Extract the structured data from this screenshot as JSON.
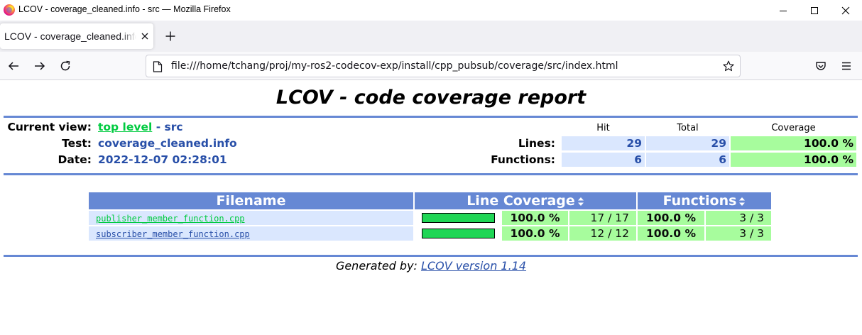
{
  "window": {
    "title": "LCOV - coverage_cleaned.info - src — Mozilla Firefox"
  },
  "tab": {
    "title": "LCOV - coverage_cleaned.info - src"
  },
  "navbar": {
    "url": "file:///home/tchang/proj/my-ros2-codecov-exp/install/cpp_pubsub/coverage/src/index.html"
  },
  "page": {
    "title": "LCOV - code coverage report",
    "header": {
      "current_view_label": "Current view:",
      "current_view_link": "top level",
      "current_view_rest": " - src",
      "test_label": "Test:",
      "test_value": "coverage_cleaned.info",
      "date_label": "Date:",
      "date_value": "2022-12-07 02:28:01",
      "col_hit": "Hit",
      "col_total": "Total",
      "col_coverage": "Coverage",
      "lines_label": "Lines:",
      "lines_hit": "29",
      "lines_total": "29",
      "lines_coverage": "100.0 %",
      "functions_label": "Functions:",
      "functions_hit": "6",
      "functions_total": "6",
      "functions_coverage": "100.0 %"
    },
    "table": {
      "headers": {
        "filename": "Filename",
        "line_coverage": "Line Coverage",
        "functions": "Functions"
      },
      "rows": [
        {
          "file": "publisher_member_function.cpp",
          "bar_fraction": 1.0,
          "line_pct": "100.0 %",
          "line_ratio": "17 / 17",
          "func_pct": "100.0 %",
          "func_ratio": "3 / 3"
        },
        {
          "file": "subscriber_member_function.cpp",
          "bar_fraction": 1.0,
          "line_pct": "100.0 %",
          "line_ratio": "12 / 12",
          "func_pct": "100.0 %",
          "func_ratio": "3 / 3"
        }
      ]
    },
    "footer": {
      "prefix": "Generated by:",
      "link": "LCOV version 1.14"
    }
  },
  "colors": {
    "ruler": "#6688d4",
    "value_blue": "#284fa8",
    "hit_bg": "#dae7fe",
    "coverage_bg": "#a7fc9d",
    "bar_green": "#1fd655",
    "link_green": "#00cb40"
  }
}
